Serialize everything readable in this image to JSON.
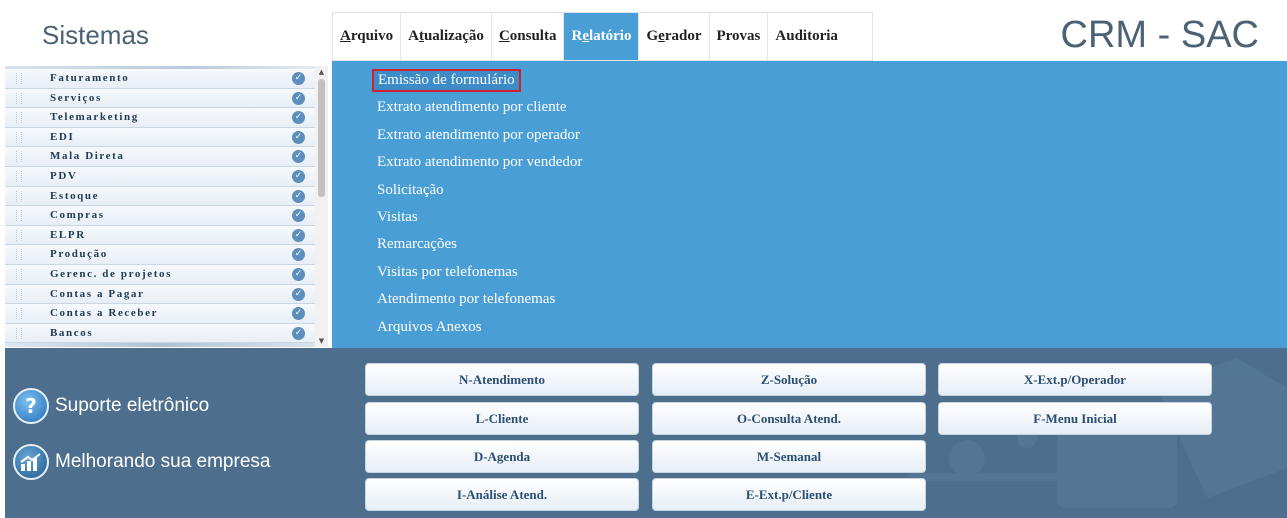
{
  "header": {
    "app_title": "Sistemas",
    "brand_title": "CRM - SAC"
  },
  "menubar": {
    "items": [
      {
        "label": "Arquivo",
        "accel_index": 0
      },
      {
        "label": "Atualização",
        "accel_index": 1
      },
      {
        "label": "Consulta",
        "accel_index": 0
      },
      {
        "label": "Relatório",
        "accel_index": 1
      },
      {
        "label": "Gerador",
        "accel_index": 1
      },
      {
        "label": "Provas",
        "accel_index": -1
      },
      {
        "label": "Auditoria",
        "accel_index": -1
      }
    ],
    "active_label": "Relatório"
  },
  "sidebar": {
    "items": [
      {
        "label": "Faturamento",
        "icon": "check-icon"
      },
      {
        "label": "Serviços",
        "icon": "check-icon"
      },
      {
        "label": "Telemarketing",
        "icon": "check-icon"
      },
      {
        "label": "EDI",
        "icon": "check-icon"
      },
      {
        "label": "Mala Direta",
        "icon": "check-icon"
      },
      {
        "label": "PDV",
        "icon": "check-icon"
      },
      {
        "label": "Estoque",
        "icon": "check-icon"
      },
      {
        "label": "Compras",
        "icon": "check-icon"
      },
      {
        "label": "ELPR",
        "icon": "check-icon"
      },
      {
        "label": "Produção",
        "icon": "check-icon"
      },
      {
        "label": "Gerenc. de projetos",
        "icon": "check-icon"
      },
      {
        "label": "Contas a Pagar",
        "icon": "check-icon"
      },
      {
        "label": "Contas a Receber",
        "icon": "check-icon"
      },
      {
        "label": "Bancos",
        "icon": "check-icon"
      }
    ]
  },
  "dropdown": {
    "items": [
      {
        "label": "Emissão de formulário",
        "selected": true
      },
      {
        "label": "Extrato atendimento por cliente"
      },
      {
        "label": "Extrato atendimento por operador"
      },
      {
        "label": "Extrato atendimento por vendedor"
      },
      {
        "label": "Solicitação"
      },
      {
        "label": "Visitas"
      },
      {
        "label": "Remarcações"
      },
      {
        "label": "Visitas por telefonemas"
      },
      {
        "label": "Atendimento por telefonemas"
      },
      {
        "label": "Arquivos Anexos"
      }
    ]
  },
  "bottom": {
    "support_label": "Suporte eletrônico",
    "improve_label": "Melhorando sua empresa",
    "support_icon": "help-icon",
    "improve_icon": "growth-chart-icon",
    "buttons": {
      "n_atendimento": "N-Atendimento",
      "l_cliente": "L-Cliente",
      "d_agenda": "D-Agenda",
      "i_analise": "I-Análise Atend.",
      "z_solucao": "Z-Solução",
      "o_consulta": "O-Consulta Atend.",
      "m_semanal": "M-Semanal",
      "e_ext_cliente": "E-Ext.p/Cliente",
      "x_ext_operador": "X-Ext.p/Operador",
      "f_menu_inicial": "F-Menu Inicial"
    }
  },
  "colors": {
    "menu_active_bg": "#4a9ed6",
    "dropdown_bg": "#4a9ed6",
    "bottom_bg": "#4d6f8d",
    "selection_border": "#d0222e",
    "title_text": "#4a6274"
  }
}
